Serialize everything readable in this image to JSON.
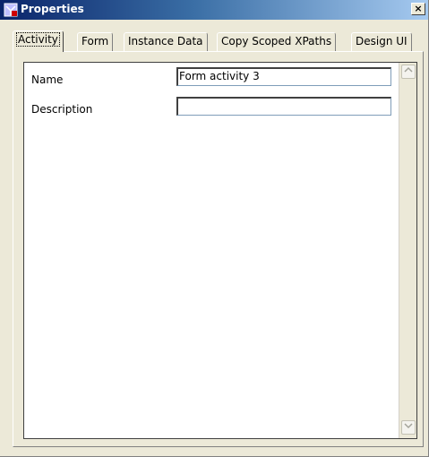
{
  "window": {
    "title": "Properties",
    "icon": "properties-app-icon",
    "close_label": "×"
  },
  "tabs": [
    {
      "label": "Activity",
      "active": true
    },
    {
      "label": "Form",
      "active": false
    },
    {
      "label": "Instance Data",
      "active": false
    },
    {
      "label": "Copy Scoped XPaths",
      "active": false
    },
    {
      "label": "Design UI",
      "active": false
    }
  ],
  "fields": {
    "name": {
      "label": "Name",
      "value": "Form activity 3"
    },
    "description": {
      "label": "Description",
      "value": ""
    }
  },
  "scrollbar": {
    "up_icon": "chevron-up-icon",
    "down_icon": "chevron-down-icon"
  }
}
